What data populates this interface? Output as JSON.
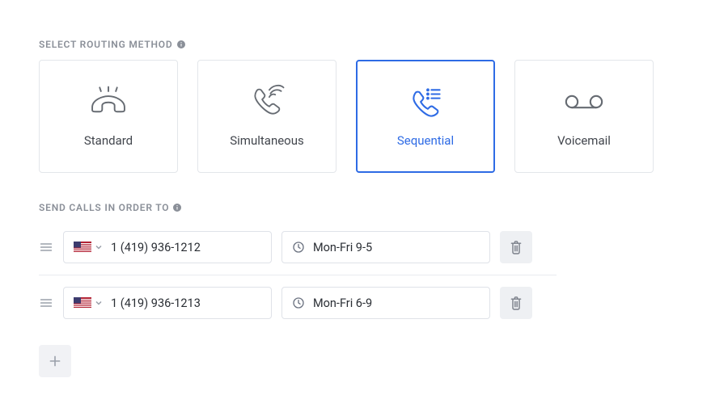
{
  "section1": {
    "title": "SELECT ROUTING METHOD"
  },
  "methods": [
    {
      "label": "Standard",
      "icon": "phone-hangup-icon",
      "selected": false
    },
    {
      "label": "Simultaneous",
      "icon": "phone-radiate-icon",
      "selected": false
    },
    {
      "label": "Sequential",
      "icon": "phone-list-icon",
      "selected": true
    },
    {
      "label": "Voicemail",
      "icon": "voicemail-icon",
      "selected": false
    }
  ],
  "section2": {
    "title": "SEND CALLS IN ORDER TO"
  },
  "rules": [
    {
      "country": "us",
      "phone": "1 (419) 936-1212",
      "schedule": "Mon-Fri 9-5"
    },
    {
      "country": "us",
      "phone": "1 (419) 936-1213",
      "schedule": "Mon-Fri 6-9"
    }
  ]
}
